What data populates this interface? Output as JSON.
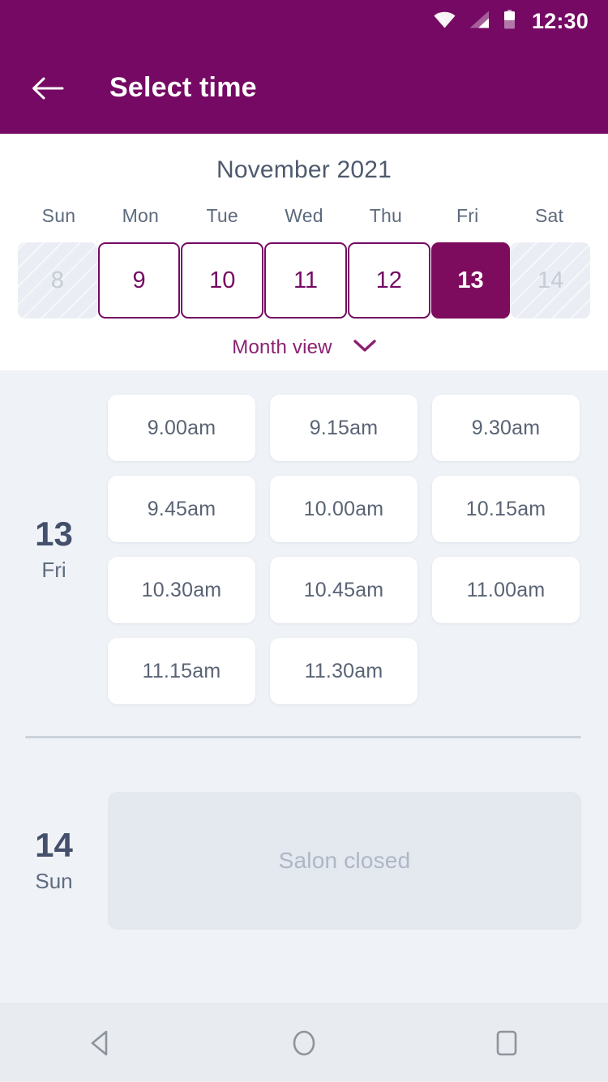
{
  "status_bar": {
    "wifi_icon": "wifi-icon",
    "signal_icon": "signal-icon",
    "battery_icon": "battery-icon",
    "clock": "12:30"
  },
  "app_bar": {
    "back_icon": "back-arrow-icon",
    "title": "Select time"
  },
  "calendar": {
    "month_title": "November 2021",
    "weekdays": [
      "Sun",
      "Mon",
      "Tue",
      "Wed",
      "Thu",
      "Fri",
      "Sat"
    ],
    "days": [
      {
        "num": "8",
        "state": "disabled"
      },
      {
        "num": "9",
        "state": "available"
      },
      {
        "num": "10",
        "state": "available"
      },
      {
        "num": "11",
        "state": "available"
      },
      {
        "num": "12",
        "state": "available"
      },
      {
        "num": "13",
        "state": "selected"
      },
      {
        "num": "14",
        "state": "disabled"
      }
    ],
    "month_view_label": "Month view",
    "chevron_icon": "chevron-down-icon"
  },
  "schedule": [
    {
      "day_number": "13",
      "day_name": "Fri",
      "slots": [
        "9.00am",
        "9.15am",
        "9.30am",
        "9.45am",
        "10.00am",
        "10.15am",
        "10.30am",
        "10.45am",
        "11.00am",
        "11.15am",
        "11.30am"
      ]
    },
    {
      "day_number": "14",
      "day_name": "Sun",
      "closed_label": "Salon closed"
    }
  ],
  "nav_bar": {
    "back_icon": "nav-back-triangle-icon",
    "home_icon": "nav-home-circle-icon",
    "recents_icon": "nav-recents-square-icon"
  },
  "colors": {
    "brand_purple": "#750963",
    "selected_purple": "#7d0b5e",
    "page_bg": "#eff2f7",
    "slot_text": "#5a6374",
    "day_text": "#44506b",
    "closed_text": "#aeb7c6"
  }
}
